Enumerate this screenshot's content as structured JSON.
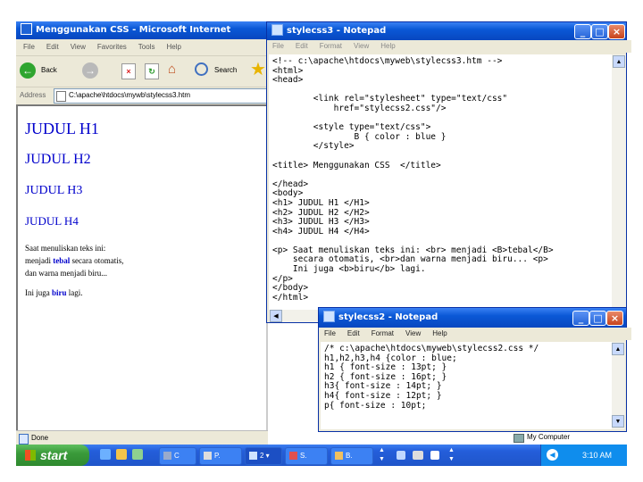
{
  "ie": {
    "title": "Menggunakan CSS - Microsoft Internet Explorer",
    "menu": [
      "File",
      "Edit",
      "View",
      "Favorites",
      "Tools",
      "Help"
    ],
    "back_label": "Back",
    "search_label": "Search",
    "address_label": "Address",
    "address_value": "C:\\apache\\htdocs\\mywb\\stylecss3.htm",
    "content": {
      "h1": "JUDUL H1",
      "h2": "JUDUL H2",
      "h3": "JUDUL H3",
      "h4": "JUDUL H4",
      "para_line1": "Saat menuliskan teks ini:",
      "para_line2_pre": "menjadi ",
      "para_line2_bold": "tebal",
      "para_line2_post": " secara otomatis,",
      "para_line3": "dan warna menjadi biru...",
      "para2_pre": "Ini juga ",
      "para2_bold": "biru",
      "para2_post": " lagi."
    },
    "status": "Done",
    "zone": "My Computer"
  },
  "notepad3": {
    "title": "stylecss3 - Notepad",
    "menu": [
      "File",
      "Edit",
      "Format",
      "View",
      "Help"
    ],
    "text": "<!-- c:\\apache\\htdocs\\myweb\\stylecss3.htm -->\n<html>\n<head>\n\n        <link rel=\"stylesheet\" type=\"text/css\"\n            href=\"stylecss2.css\"/>\n\n        <style type=\"text/css\">\n                B { color : blue }\n        </style>\n\n<title> Menggunakan CSS  </title>\n\n</head>\n<body>\n<h1> JUDUL H1 </H1>\n<h2> JUDUL H2 </H2>\n<h3> JUDUL H3 </H3>\n<h4> JUDUL H4 </H4>\n\n<p> Saat menuliskan teks ini: <br> menjadi <B>tebal</B>\n    secara otomatis, <br>dan warna menjadi biru... <p>\n    Ini juga <b>biru</b> lagi.\n</p>\n</body>\n</html>"
  },
  "notepad2": {
    "title": "stylecss2 - Notepad",
    "menu": [
      "File",
      "Edit",
      "Format",
      "View",
      "Help"
    ],
    "text": "/* c:\\apache\\htdocs\\myweb\\stylecss2.css */\nh1,h2,h3,h4 {color : blue;\nh1 { font-size : 13pt; }\nh2 { font-size : 16pt; }\nh3{ font-size : 14pt; }\nh4{ font-size : 12pt; }\np{ font-size : 10pt;"
  },
  "taskbar": {
    "start": "start",
    "items": [
      "C",
      "P.",
      "2",
      "S.",
      "B."
    ],
    "clock": "3:10 AM"
  },
  "colors": {
    "heading_blue": "#0000cc",
    "xp_blue": "#0a58d6",
    "start_green": "#3a9a3a"
  }
}
